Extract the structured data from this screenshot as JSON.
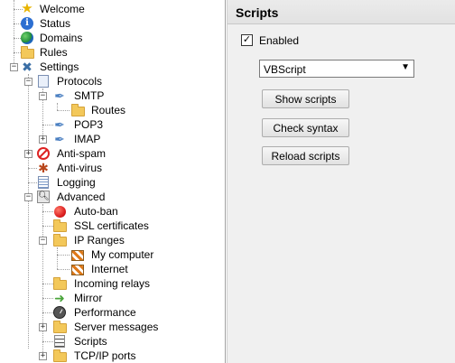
{
  "tree": {
    "items": [
      {
        "label": "Welcome",
        "icon": "star-icon"
      },
      {
        "label": "Status",
        "icon": "info-icon"
      },
      {
        "label": "Domains",
        "icon": "globe-icon"
      },
      {
        "label": "Rules",
        "icon": "folder-icon"
      },
      {
        "label": "Settings",
        "icon": "tools-icon",
        "expanded": true
      },
      {
        "label": "Protocols",
        "icon": "document-icon",
        "expanded": true
      },
      {
        "label": "SMTP",
        "icon": "quill-icon",
        "expanded": true
      },
      {
        "label": "Routes",
        "icon": "folder-icon"
      },
      {
        "label": "POP3",
        "icon": "quill-icon"
      },
      {
        "label": "IMAP",
        "icon": "quill-icon",
        "expanded": false
      },
      {
        "label": "Anti-spam",
        "icon": "no-entry-icon",
        "expanded": false
      },
      {
        "label": "Anti-virus",
        "icon": "bug-icon"
      },
      {
        "label": "Logging",
        "icon": "log-icon"
      },
      {
        "label": "Advanced",
        "icon": "magnifier-icon",
        "expanded": true
      },
      {
        "label": "Auto-ban",
        "icon": "red-circle-icon"
      },
      {
        "label": "SSL certificates",
        "icon": "folder-icon"
      },
      {
        "label": "IP Ranges",
        "icon": "folder-icon",
        "expanded": true
      },
      {
        "label": "My computer",
        "icon": "barrier-icon"
      },
      {
        "label": "Internet",
        "icon": "barrier-icon"
      },
      {
        "label": "Incoming relays",
        "icon": "folder-icon"
      },
      {
        "label": "Mirror",
        "icon": "arrow-icon"
      },
      {
        "label": "Performance",
        "icon": "gauge-icon"
      },
      {
        "label": "Server messages",
        "icon": "folder-icon",
        "expanded": false
      },
      {
        "label": "Scripts",
        "icon": "script-icon",
        "selected": true
      },
      {
        "label": "TCP/IP ports",
        "icon": "folder-icon",
        "expanded": false
      }
    ]
  },
  "panel": {
    "title": "Scripts",
    "enabled_label": "Enabled",
    "enabled_checked": true,
    "check_mark": "✓",
    "language_value": "VBScript",
    "buttons": {
      "show": "Show scripts",
      "check": "Check syntax",
      "reload": "Reload scripts"
    }
  },
  "expander": {
    "plus": "+",
    "minus": "−"
  },
  "dropdown_arrow": "▼"
}
